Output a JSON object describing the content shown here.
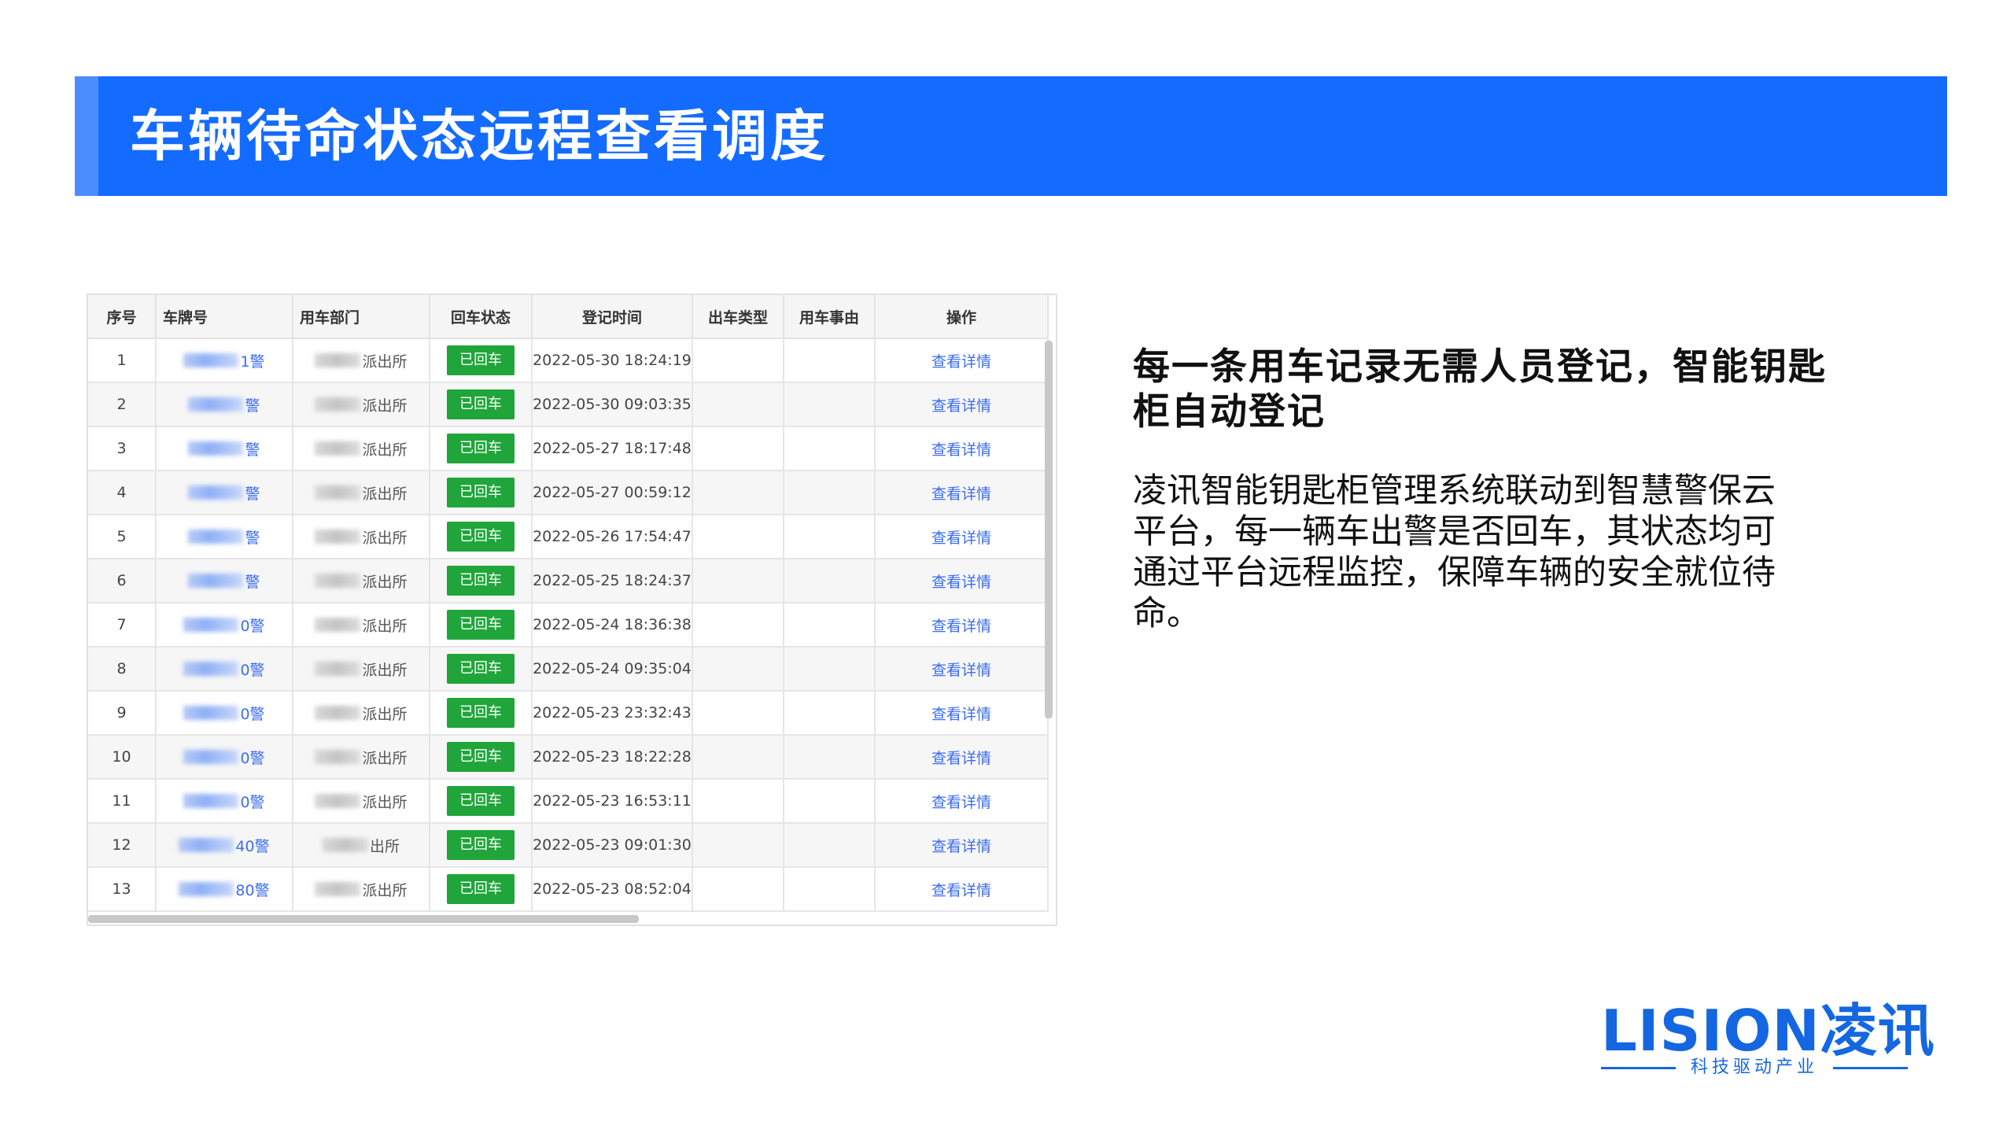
{
  "slide": {
    "title": "车辆待命状态远程查看调度",
    "headline": "每一条用车记录无需人员登记，智能钥匙柜自动登记",
    "body": "凌讯智能钥匙柜管理系统联动到智慧警保云平台，每一辆车出警是否回车，其状态均可通过平台远程监控，保障车辆的安全就位待命。"
  },
  "table": {
    "columns": [
      "序号",
      "车牌号",
      "用车部门",
      "回车状态",
      "登记时间",
      "出车类型",
      "用车事由",
      "操作"
    ],
    "rows": [
      {
        "no": "1",
        "plate": "1警",
        "dept": "派出所",
        "status": "已回车",
        "time": "2022-05-30 18:24:19",
        "type": "",
        "reason": "",
        "action": "查看详情"
      },
      {
        "no": "2",
        "plate": "警",
        "dept": "派出所",
        "status": "已回车",
        "time": "2022-05-30 09:03:35",
        "type": "",
        "reason": "",
        "action": "查看详情"
      },
      {
        "no": "3",
        "plate": "警",
        "dept": "派出所",
        "status": "已回车",
        "time": "2022-05-27 18:17:48",
        "type": "",
        "reason": "",
        "action": "查看详情"
      },
      {
        "no": "4",
        "plate": "警",
        "dept": "派出所",
        "status": "已回车",
        "time": "2022-05-27 00:59:12",
        "type": "",
        "reason": "",
        "action": "查看详情"
      },
      {
        "no": "5",
        "plate": "警",
        "dept": "派出所",
        "status": "已回车",
        "time": "2022-05-26 17:54:47",
        "type": "",
        "reason": "",
        "action": "查看详情"
      },
      {
        "no": "6",
        "plate": "警",
        "dept": "派出所",
        "status": "已回车",
        "time": "2022-05-25 18:24:37",
        "type": "",
        "reason": "",
        "action": "查看详情"
      },
      {
        "no": "7",
        "plate": "0警",
        "dept": "派出所",
        "status": "已回车",
        "time": "2022-05-24 18:36:38",
        "type": "",
        "reason": "",
        "action": "查看详情"
      },
      {
        "no": "8",
        "plate": "0警",
        "dept": "派出所",
        "status": "已回车",
        "time": "2022-05-24 09:35:04",
        "type": "",
        "reason": "",
        "action": "查看详情"
      },
      {
        "no": "9",
        "plate": "0警",
        "dept": "派出所",
        "status": "已回车",
        "time": "2022-05-23 23:32:43",
        "type": "",
        "reason": "",
        "action": "查看详情"
      },
      {
        "no": "10",
        "plate": "0警",
        "dept": "派出所",
        "status": "已回车",
        "time": "2022-05-23 18:22:28",
        "type": "",
        "reason": "",
        "action": "查看详情"
      },
      {
        "no": "11",
        "plate": "0警",
        "dept": "派出所",
        "status": "已回车",
        "time": "2022-05-23 16:53:11",
        "type": "",
        "reason": "",
        "action": "查看详情"
      },
      {
        "no": "12",
        "plate": "40警",
        "dept": "出所",
        "status": "已回车",
        "time": "2022-05-23 09:01:30",
        "type": "",
        "reason": "",
        "action": "查看详情"
      },
      {
        "no": "13",
        "plate": "80警",
        "dept": "派出所",
        "status": "已回车",
        "time": "2022-05-23 08:52:04",
        "type": "",
        "reason": "",
        "action": "查看详情"
      }
    ]
  },
  "logo": {
    "name": "LISION凌讯",
    "tagline": "科技驱动产业"
  },
  "colors": {
    "banner": "#146bff",
    "status_green": "#20a53a",
    "link_blue": "#3c6cf0",
    "logo_blue": "#1467e0"
  }
}
